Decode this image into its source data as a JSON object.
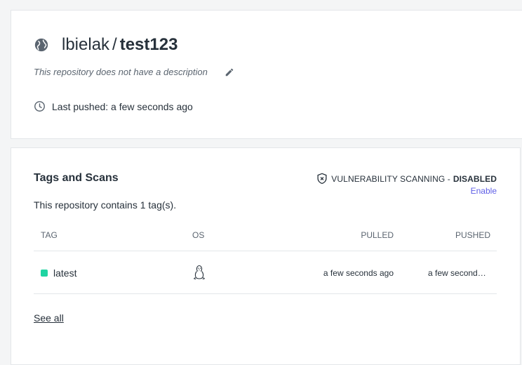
{
  "repo": {
    "namespace": "lbielak",
    "separator": "/",
    "name": "test123",
    "description": "This repository does not have a description",
    "last_pushed": "Last pushed: a few seconds ago",
    "icons": {
      "visibility": "globe-icon",
      "edit": "pencil-icon",
      "time": "clock-icon"
    }
  },
  "tags_section": {
    "title": "Tags and Scans",
    "vuln_label": "Vulnerability Scanning -",
    "vuln_status": "DISABLED",
    "enable_link": "Enable",
    "count_text": "This repository contains 1 tag(s).",
    "columns": {
      "tag": "TAG",
      "os": "OS",
      "pulled": "PULLED",
      "pushed": "PUSHED"
    },
    "rows": [
      {
        "tag": "latest",
        "os": "linux-icon",
        "pulled": "a few seconds ago",
        "pushed": "a few seconds ago"
      }
    ],
    "see_all": "See all"
  },
  "colors": {
    "tag_status": "#1fd4a2",
    "link": "#5e5ee6",
    "text": "#27313b"
  }
}
